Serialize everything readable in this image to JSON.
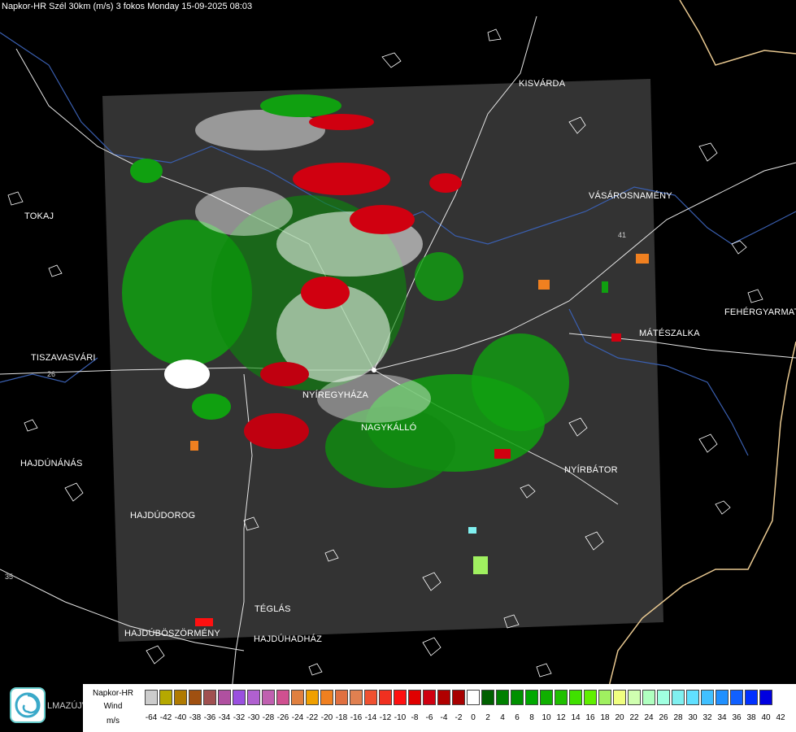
{
  "title": "Napkor-HR Szél 30km (m/s) 3 fokos Monday 15-09-2025 08:03",
  "cities": [
    {
      "name": "KISVÁRDA",
      "id": "kisvarda"
    },
    {
      "name": "TOKAJ",
      "id": "tokaj"
    },
    {
      "name": "VÁSÁROSNAMÉNY",
      "id": "vasarosnameny"
    },
    {
      "name": "FEHÉRGYARMAT",
      "id": "fehergyarmat"
    },
    {
      "name": "MÁTÉSZALKA",
      "id": "mateszalka"
    },
    {
      "name": "TISZAVASVÁRI",
      "id": "tiszavasvari"
    },
    {
      "name": "NYÍREGYHÁZA",
      "id": "nyiregyhaza"
    },
    {
      "name": "NAGYKÁLLÓ",
      "id": "nagykallo"
    },
    {
      "name": "HAJDÚNÁNÁS",
      "id": "hajdunanas"
    },
    {
      "name": "NYÍRBÁTOR",
      "id": "nyirbator"
    },
    {
      "name": "HAJDÚDOROG",
      "id": "hajdudorog"
    },
    {
      "name": "TÉGLÁS",
      "id": "teglas"
    },
    {
      "name": "HAJDÚBÖSZÖRMÉNY",
      "id": "hajduboszormeny"
    },
    {
      "name": "HAJDÚHADHÁZ",
      "id": "hajduhadhaz"
    }
  ],
  "road_labels": [
    "26",
    "41",
    "35"
  ],
  "legend": {
    "line1": "Napkor-HR",
    "line2": "Wind",
    "line3": "m/s",
    "ticks": [
      "-64",
      "-42",
      "-40",
      "-38",
      "-36",
      "-34",
      "-32",
      "-30",
      "-28",
      "-26",
      "-24",
      "-22",
      "-20",
      "-18",
      "-16",
      "-14",
      "-12",
      "-10",
      "-8",
      "-6",
      "-4",
      "-2",
      "0",
      "2",
      "4",
      "6",
      "8",
      "10",
      "12",
      "14",
      "16",
      "18",
      "20",
      "22",
      "24",
      "26",
      "28",
      "30",
      "32",
      "34",
      "36",
      "38",
      "40",
      "42"
    ],
    "colors": [
      "#cccccc",
      "#b5a800",
      "#b07a00",
      "#a05010",
      "#a05050",
      "#b050a0",
      "#9a50e0",
      "#b060d0",
      "#c060b0",
      "#d05090",
      "#e08040",
      "#f0a000",
      "#f08020",
      "#e07040",
      "#e08050",
      "#f05030",
      "#f03020",
      "#ff1010",
      "#e00000",
      "#d00010",
      "#b00000",
      "#a80000",
      "#ffffff",
      "#006000",
      "#008000",
      "#009000",
      "#00a800",
      "#10b000",
      "#20c000",
      "#40e000",
      "#60f000",
      "#a0f060",
      "#f0ff80",
      "#d0ffb0",
      "#b0ffc0",
      "#a0ffe0",
      "#80f0f0",
      "#60e0ff",
      "#40c0ff",
      "#2090ff",
      "#1060ff",
      "#0030ff",
      "#0000e0"
    ]
  },
  "logo_text": "LMAZÚJVÁR",
  "accent_colors": {
    "radar_bg": "#333333",
    "inbound": "#d00010",
    "outbound": "#10a010"
  }
}
